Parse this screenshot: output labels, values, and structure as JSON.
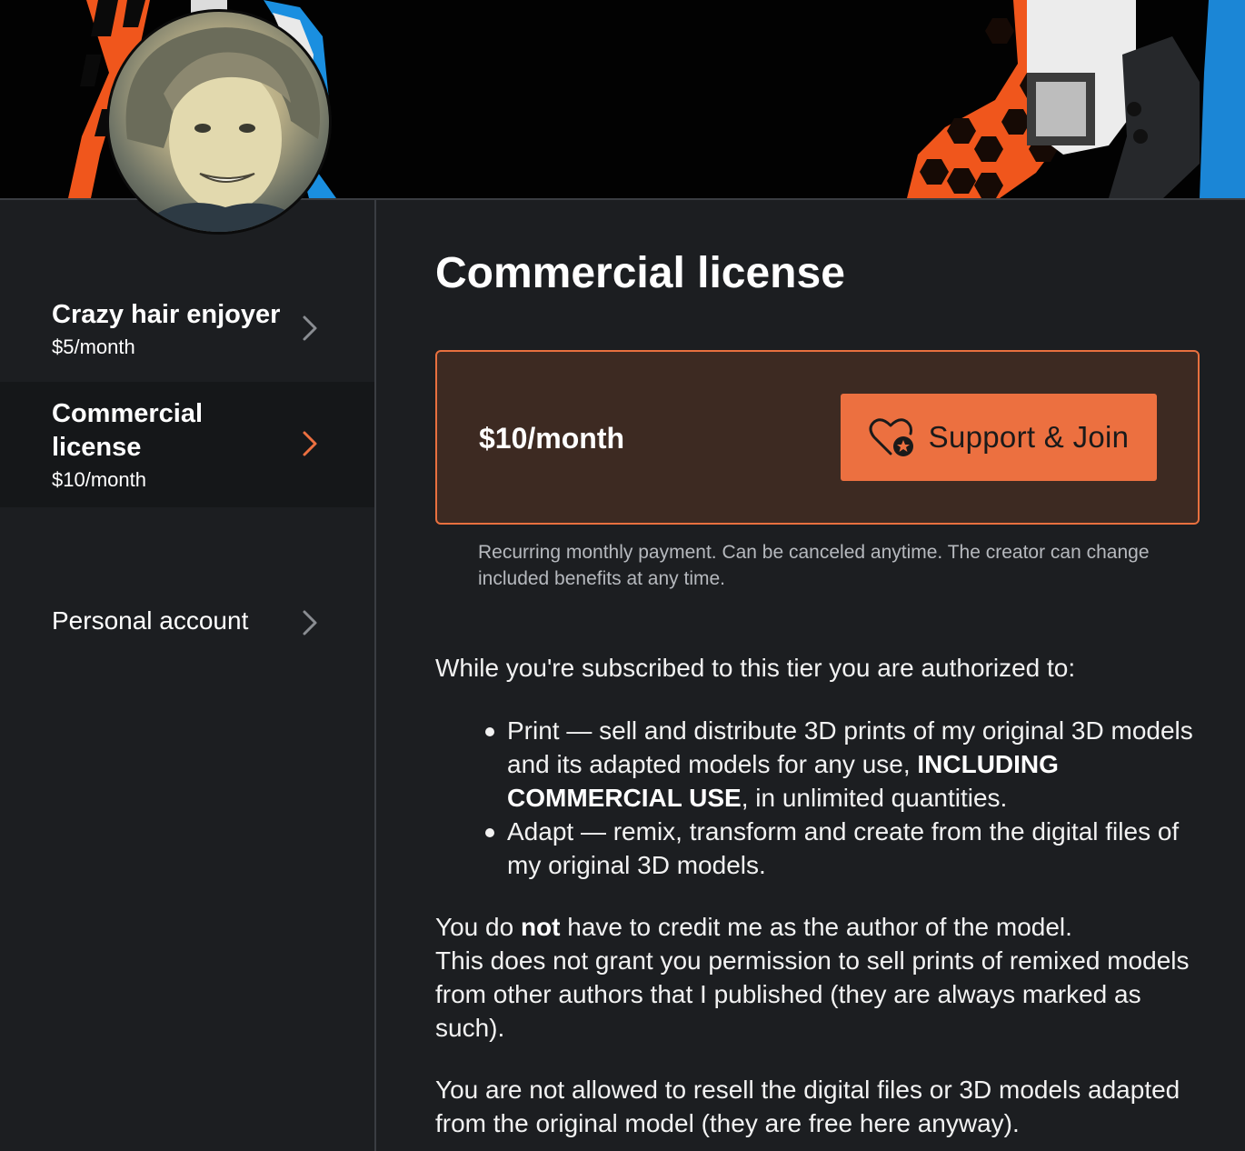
{
  "sidebar": {
    "tiers": [
      {
        "name": "Crazy hair enjoyer",
        "price": "$5/month"
      },
      {
        "name": "Commercial license",
        "price": "$10/month"
      }
    ],
    "personal_account": "Personal account"
  },
  "main": {
    "title": "Commercial license",
    "card": {
      "price": "$10/month",
      "join_button": "Support & Join"
    },
    "recurring_note": "Recurring monthly payment. Can be canceled anytime. The creator can change included benefits at any time.",
    "intro": "While you're subscribed to this tier you are authorized to:",
    "benefits": [
      {
        "text_before": "Print — sell and distribute 3D prints of my original 3D models and its adapted models for any use, ",
        "bold": "INCLUDING COMMERCIAL USE",
        "text_after": ", in unlimited quantities."
      },
      {
        "text": "Adapt — remix, transform and create from the digital files of my original 3D models."
      }
    ],
    "credit": {
      "before": "You do ",
      "bold": "not",
      "after": " have to credit me as the author of the model.",
      "line2": "This does not grant you permission to sell prints of remixed models from other authors that I published (they are always marked as such)."
    },
    "resell": "You are not allowed to resell the digital files or 3D models adapted from the original model (they are free here anyway)."
  },
  "colors": {
    "accent": "#ec7040",
    "card_background": "#3d2a22",
    "page_background": "#1c1e21",
    "selected_tier_background": "#151719"
  }
}
